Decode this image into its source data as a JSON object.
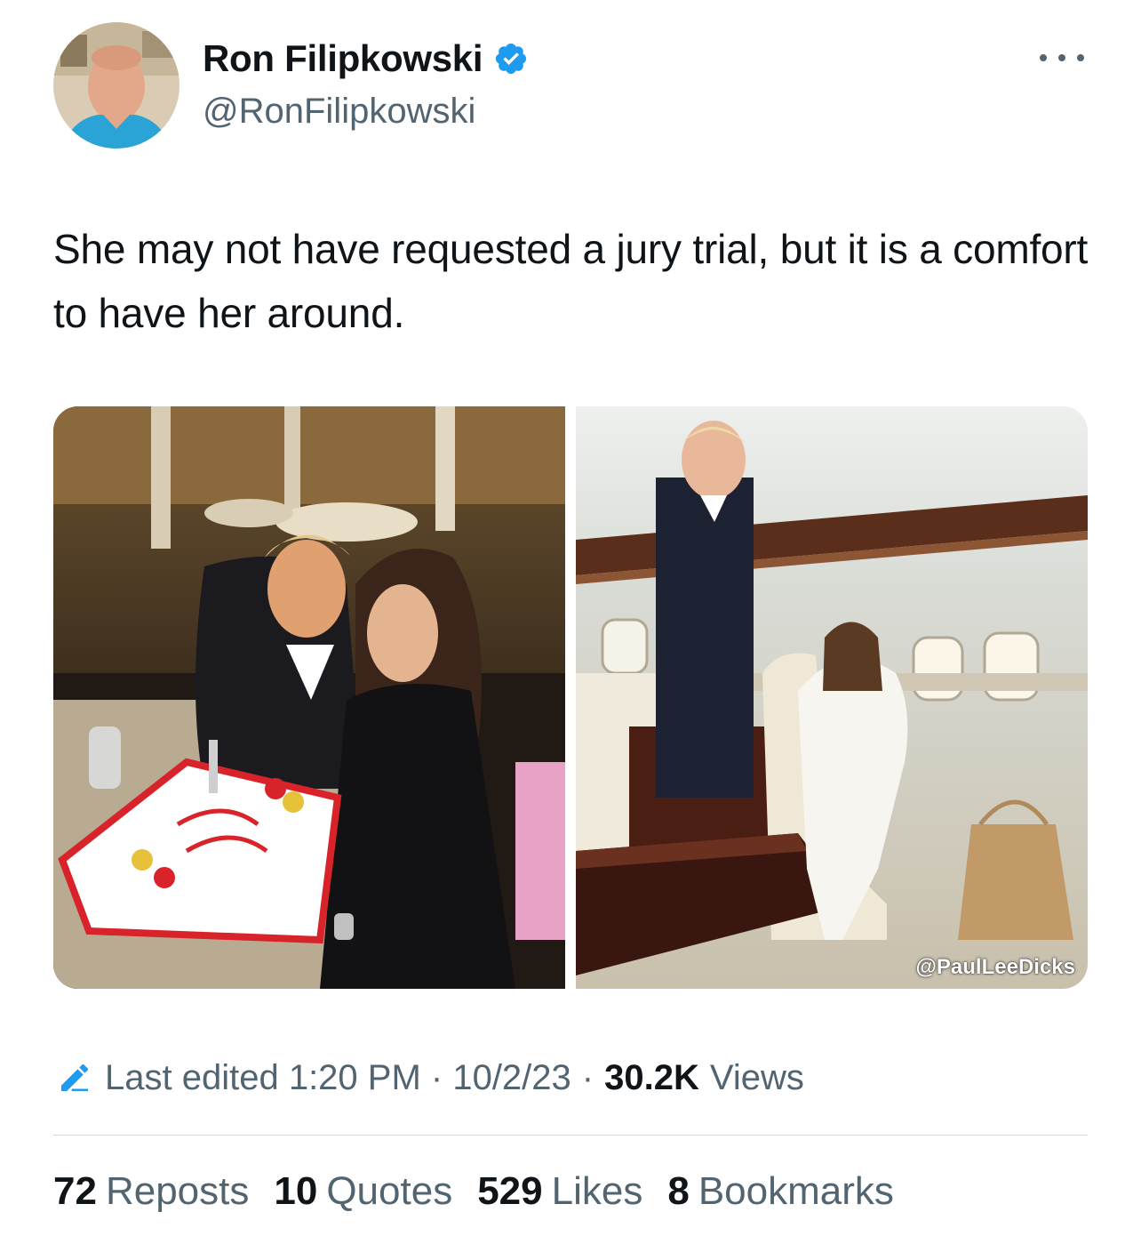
{
  "author": {
    "display_name": "Ron Filipkowski",
    "handle": "@RonFilipkowski",
    "verified": true,
    "avatar_icon": "profile-photo"
  },
  "tweet": {
    "text": "She may not have requested a jury trial, but it is a comfort to have her around."
  },
  "media": {
    "items": [
      {
        "icon": "photo-birthday-cake-restaurant"
      },
      {
        "icon": "photo-airplane-cabin",
        "watermark": "@PaulLeeDicks"
      }
    ]
  },
  "meta": {
    "edited_label": "Last edited 1:20 PM · 10/2/23",
    "separator": "·",
    "views_count": "30.2K",
    "views_label": "Views"
  },
  "stats": {
    "reposts_count": "72",
    "reposts_label": "Reposts",
    "quotes_count": "10",
    "quotes_label": "Quotes",
    "likes_count": "529",
    "likes_label": "Likes",
    "bookmarks_count": "8",
    "bookmarks_label": "Bookmarks"
  },
  "colors": {
    "text_primary": "#0f1419",
    "text_secondary": "#536471",
    "verified_blue": "#1d9bf0",
    "divider": "#cfd9de"
  }
}
